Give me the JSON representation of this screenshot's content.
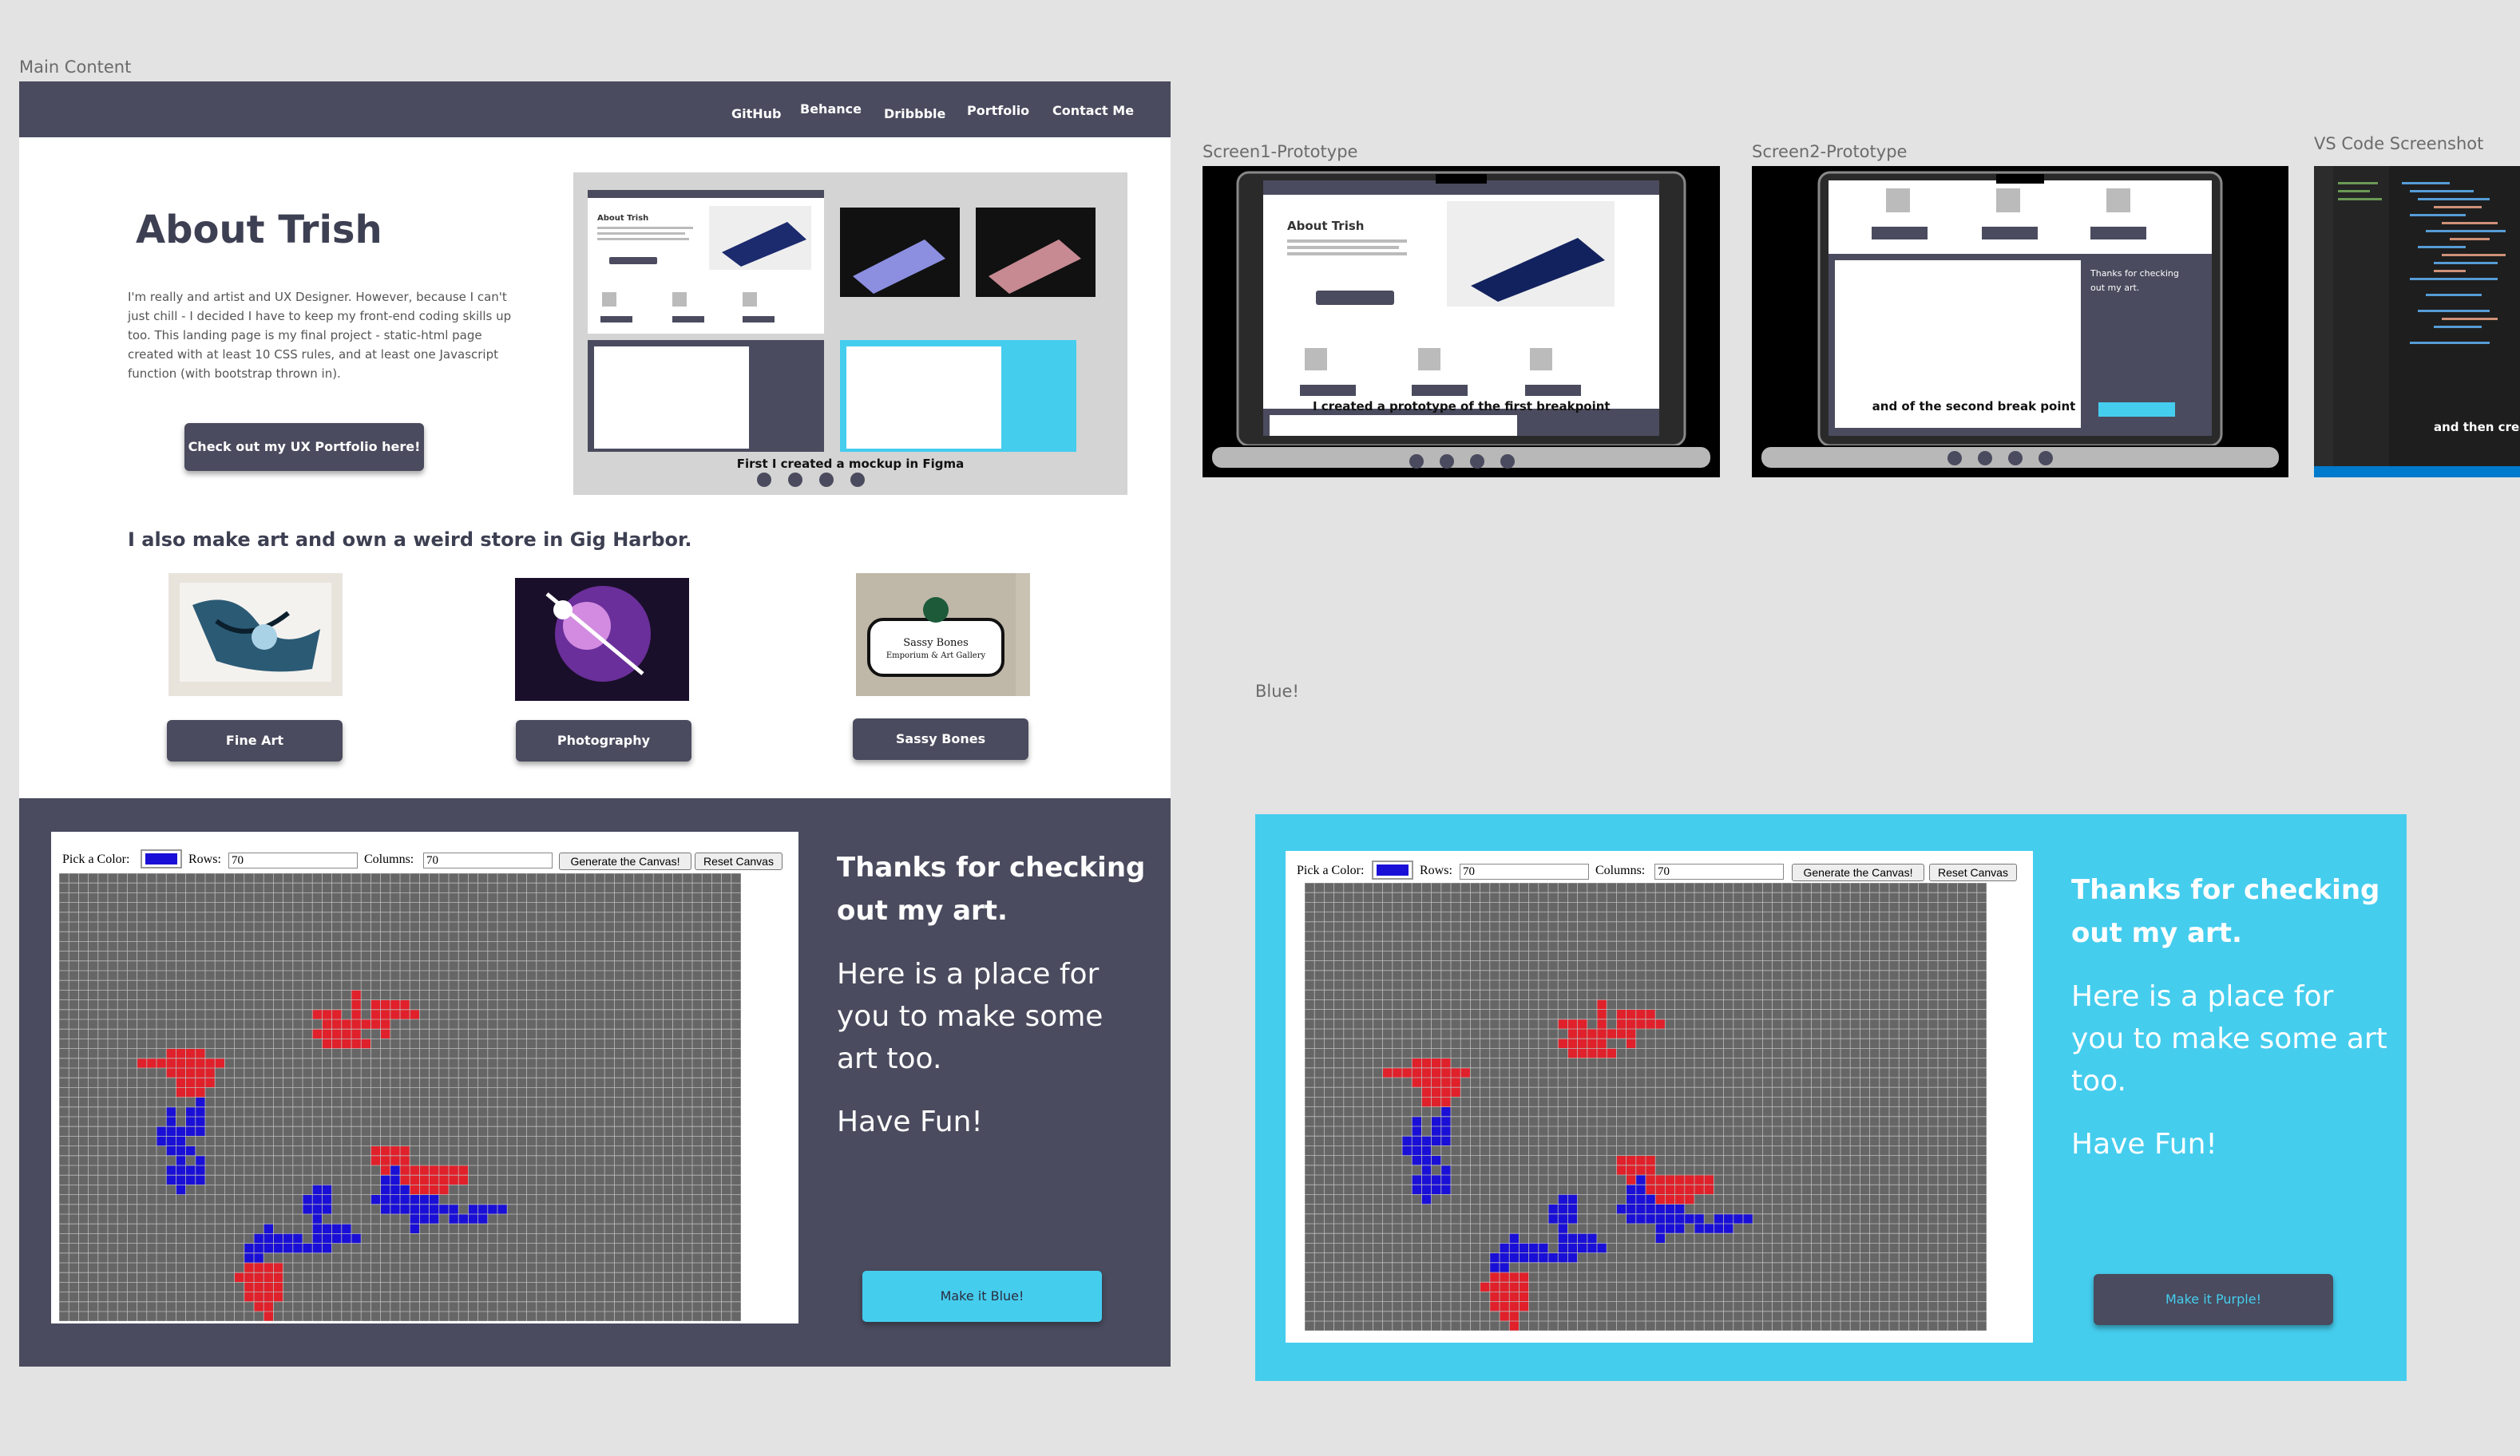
{
  "labels": {
    "main_content": "Main Content",
    "screen1": "Screen1-Prototype",
    "screen2": "Screen2-Prototype",
    "vscode": "VS Code Screenshot",
    "blue": "Blue!"
  },
  "nav": {
    "links": [
      "GitHub",
      "Behance",
      "Dribbble",
      "Portfolio",
      "Contact Me"
    ]
  },
  "about": {
    "title": "About Trish",
    "body": "I'm really and artist and UX Designer. However, because I can't just chill - I decided I have to keep my front-end coding skills up too. This landing page is my final project - static-html page created with at least 10 CSS rules, and at least one Javascript function (with bootstrap thrown in).",
    "button": "Check out my UX Portfolio here!"
  },
  "mockup": {
    "caption": "First I created a mockup in Figma"
  },
  "store": {
    "heading": "I also make art and own a weird store in Gig Harbor.",
    "items": [
      {
        "label": "Fine Art"
      },
      {
        "label": "Photography"
      },
      {
        "label": "Sassy Bones"
      }
    ],
    "sassy_logo_lines": [
      "Sassy Bones",
      "Emporium & Art Gallery"
    ]
  },
  "canvas_controls": {
    "pick_color": "Pick a Color:",
    "rows_label": "Rows:",
    "rows_value": "70",
    "columns_label": "Columns:",
    "columns_value": "70",
    "generate": "Generate the Canvas!",
    "reset": "Reset Canvas",
    "picked_color": "#1a0fd6"
  },
  "thanks": {
    "heading": "Thanks for checking out my art.",
    "para1": "Here is a place for you to make some art too.",
    "para2": "Have Fun!"
  },
  "main_frame": {
    "toggle_button": "Make it Blue!"
  },
  "blue_frame": {
    "toggle_button": "Make it Purple!"
  },
  "screen1": {
    "caption": "I created a prototype of the first breakpoint"
  },
  "screen2": {
    "caption": "and of the second break point"
  },
  "vscode": {
    "caption": "and then crea"
  },
  "colors": {
    "dark_slate": "#4a4b5e",
    "cyan": "#45cdee",
    "grid_bg": "#666666",
    "paint_red": "#e0202a",
    "paint_blue": "#1a0fd6"
  }
}
